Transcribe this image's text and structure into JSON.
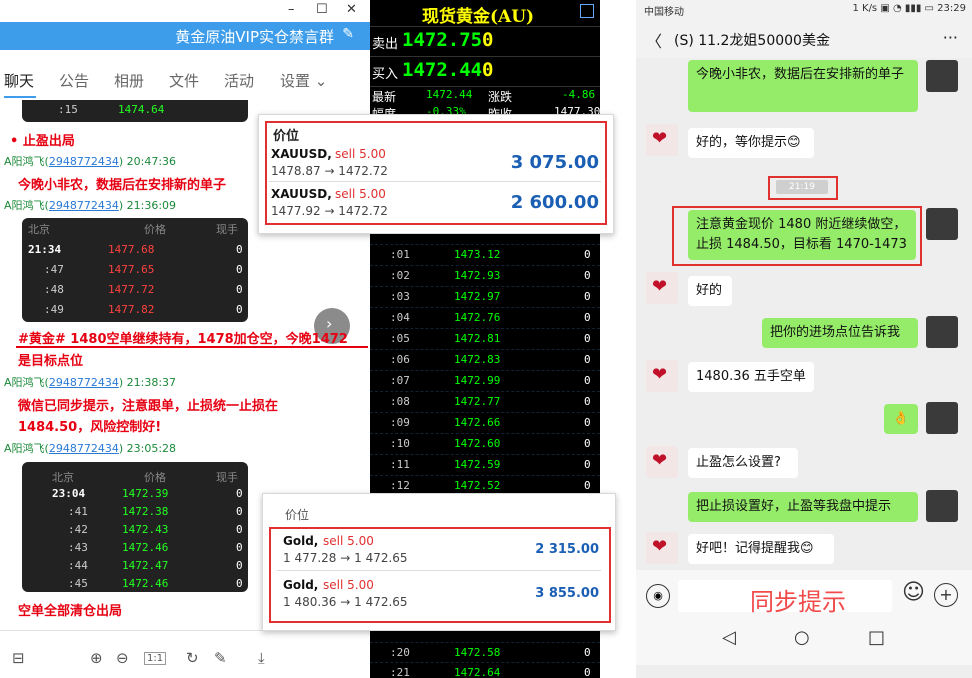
{
  "qq": {
    "win": {
      "minimize": "–",
      "maximize": "☐",
      "close": "✕"
    },
    "group_title": "黄金原油VIP实仓禁言群",
    "edit_icon": "✎",
    "tabs": [
      "聊天",
      "公告",
      "相册",
      "文件",
      "活动",
      "设置 ⌄"
    ],
    "img1_row": {
      "t": ":15",
      "p": "1474.64"
    },
    "msg_stop": "• 止盈出局",
    "meta1": {
      "name": "A阳鸿飞",
      "id": "2948772434",
      "time": "20:47:36"
    },
    "msg1": "今晚小非农，数据后在安排新的单子",
    "meta2": {
      "name": "A阳鸿飞",
      "id": "2948772434",
      "time": "21:36:09"
    },
    "img2": {
      "header": [
        "北京",
        "价格",
        "现手"
      ],
      "rows": [
        {
          "t": "21:34",
          "p": "1477.68",
          "v": "0"
        },
        {
          "t": ":47",
          "p": "1477.65",
          "v": "0"
        },
        {
          "t": ":48",
          "p": "1477.72",
          "v": "0"
        },
        {
          "t": ":49",
          "p": "1477.82",
          "v": "0"
        }
      ]
    },
    "msg2a": "#黄金# 1480空单继续持有，1478加仓空，今晚1472",
    "msg2b": "是目标点位",
    "meta3": {
      "name": "A阳鸿飞",
      "id": "2948772434",
      "time": "21:38:37"
    },
    "msg3a": "微信已同步提示，注意跟单，止损统一止损在",
    "msg3b": "1484.50，风险控制好!",
    "meta4": {
      "name": "A阳鸿飞",
      "id": "2948772434",
      "time": "23:05:28"
    },
    "img3": {
      "header": [
        "北京",
        "价格",
        "现手"
      ],
      "rows": [
        {
          "t": "23:04",
          "p": "1472.39",
          "v": "0"
        },
        {
          "t": ":41",
          "p": "1472.38",
          "v": "0"
        },
        {
          "t": ":42",
          "p": "1472.43",
          "v": "0"
        },
        {
          "t": ":43",
          "p": "1472.46",
          "v": "0"
        },
        {
          "t": ":44",
          "p": "1472.47",
          "v": "0"
        },
        {
          "t": ":45",
          "p": "1472.46",
          "v": "0"
        }
      ]
    },
    "msg4": "空单全部清仓出局",
    "toolbar": {
      "layout": "⊟",
      "zoom_in": "⊕",
      "zoom_out": "⊖",
      "actual": "1:1",
      "rotate": "↻",
      "edit": "✎",
      "download": "⤓"
    }
  },
  "terminal": {
    "title": "现货黄金(AU)",
    "sell_label": "卖出",
    "sell_price": "1472.75",
    "sell_vol": "0",
    "buy_label": "买入",
    "buy_price": "1472.44",
    "buy_vol": "0",
    "last_label": "最新",
    "last_value": "1472.44",
    "change_label": "涨跌",
    "change_value": "-4.86",
    "amp_label": "幅度",
    "amp_value": "-0.33%",
    "prev_label": "昨收",
    "prev_value": "1477.30",
    "ticks": [
      {
        "t": ":01",
        "p": "1473.12",
        "v": "0"
      },
      {
        "t": ":02",
        "p": "1472.93",
        "v": "0"
      },
      {
        "t": ":03",
        "p": "1472.97",
        "v": "0"
      },
      {
        "t": ":04",
        "p": "1472.76",
        "v": "0"
      },
      {
        "t": ":05",
        "p": "1472.81",
        "v": "0"
      },
      {
        "t": ":06",
        "p": "1472.83",
        "v": "0"
      },
      {
        "t": ":07",
        "p": "1472.99",
        "v": "0"
      },
      {
        "t": ":08",
        "p": "1472.77",
        "v": "0"
      },
      {
        "t": ":09",
        "p": "1472.66",
        "v": "0"
      },
      {
        "t": ":10",
        "p": "1472.60",
        "v": "0"
      },
      {
        "t": ":11",
        "p": "1472.59",
        "v": "0"
      },
      {
        "t": ":12",
        "p": "1472.52",
        "v": "0"
      }
    ],
    "ticks_bottom": [
      {
        "t": ":20",
        "p": "1472.58",
        "v": "0"
      },
      {
        "t": ":21",
        "p": "1472.64",
        "v": "0"
      }
    ]
  },
  "pop1": {
    "header": "价位",
    "rows": [
      {
        "sym": "XAUUSD,",
        "side": "sell 5.00",
        "prices": "1478.87 → 1472.72",
        "profit": "3 075.00"
      },
      {
        "sym": "XAUUSD,",
        "side": "sell 5.00",
        "prices": "1477.92 → 1472.72",
        "profit": "2 600.00"
      }
    ]
  },
  "pop2": {
    "header": "价位",
    "rows": [
      {
        "sym": "Gold,",
        "side": "sell 5.00",
        "prices": "1 477.28 → 1 472.65",
        "profit": "2 315.00"
      },
      {
        "sym": "Gold,",
        "side": "sell 5.00",
        "prices": "1 480.36 → 1 472.65",
        "profit": "3 855.00"
      }
    ]
  },
  "phone": {
    "status_left": "中国移动",
    "status_right": "1 K/s ▣ ◔ ▮▮▮ ▭ 23:29",
    "back": "〈",
    "chat_title": "(S) 11.2龙姐50000美金",
    "more": "···",
    "messages": [
      {
        "from": "me",
        "text": "今晚小非农，数据后在安排新的单子"
      },
      {
        "from": "her",
        "text": "好的，等你提示😊"
      },
      {
        "from": "time",
        "text": "21:19"
      },
      {
        "from": "me",
        "text": "注意黄金现价 1480 附近继续做空，止损 1484.50，目标看 1470-1473"
      },
      {
        "from": "her",
        "text": "好的"
      },
      {
        "from": "me",
        "text": "把你的进场点位告诉我"
      },
      {
        "from": "her",
        "text": "1480.36 五手空单"
      },
      {
        "from": "me",
        "text": "👌"
      },
      {
        "from": "her",
        "text": "止盈怎么设置?"
      },
      {
        "from": "me",
        "text": "把止损设置好，止盈等我盘中提示"
      },
      {
        "from": "her",
        "text": "好吧！记得提醒我😊"
      }
    ],
    "voice_icon": "◉",
    "overlay_text": "同步提示",
    "emoji_icon": "☺",
    "plus_icon": "+",
    "nav": {
      "back": "◁",
      "home": "○",
      "recent": "□"
    }
  },
  "colors": {
    "qq_blue": "#3e9dea",
    "alert_red": "#e60012",
    "wx_green": "#95ec69",
    "term_yellow": "#ffff00",
    "term_green": "#00ff00"
  }
}
